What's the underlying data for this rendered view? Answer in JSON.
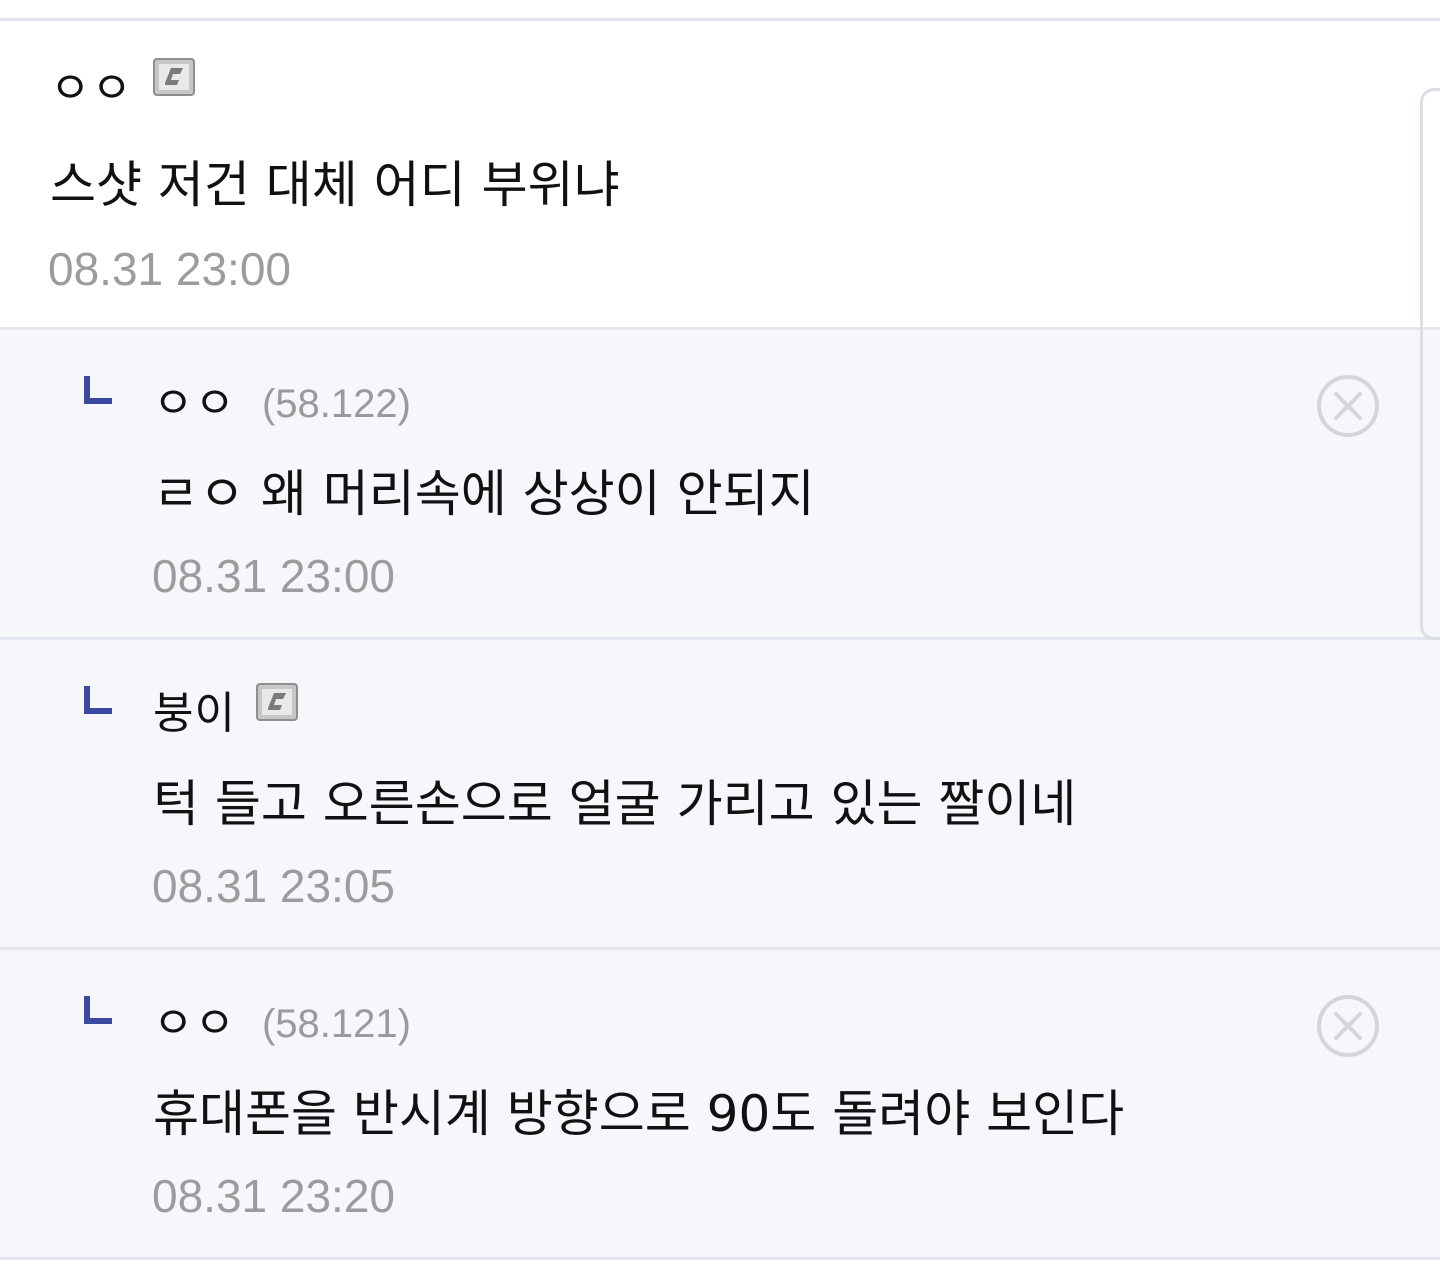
{
  "comments": [
    {
      "nickname": "ㅇㅇ",
      "ip": "",
      "has_member_icon": true,
      "text": "스샷 저건 대체 어디 부위냐",
      "time": "08.31 23:00"
    },
    {
      "nickname": "ㅇㅇ",
      "ip": "(58.122)",
      "has_member_icon": false,
      "text": "ㄹㅇ 왜 머리속에 상상이 안되지",
      "time": "08.31 23:00",
      "deletable": true
    },
    {
      "nickname": "붕이",
      "ip": "",
      "has_member_icon": true,
      "text": "턱 들고 오른손으로 얼굴 가리고 있는 짤이네",
      "time": "08.31 23:05"
    },
    {
      "nickname": "ㅇㅇ",
      "ip": "(58.121)",
      "has_member_icon": false,
      "text": "휴대폰을 반시계 방향으로 90도 돌려야 보인다",
      "time": "08.31 23:20",
      "deletable": true
    }
  ],
  "colors": {
    "reply_background": "#f6f7fb",
    "divider": "#e3e6ee",
    "reply_mark": "#3b4aa0",
    "meta_text": "#9c9c9c"
  },
  "icons": {
    "member": "fixed-nick-icon",
    "reply": "reply-arrow-icon",
    "delete": "delete-circle-x-icon"
  }
}
